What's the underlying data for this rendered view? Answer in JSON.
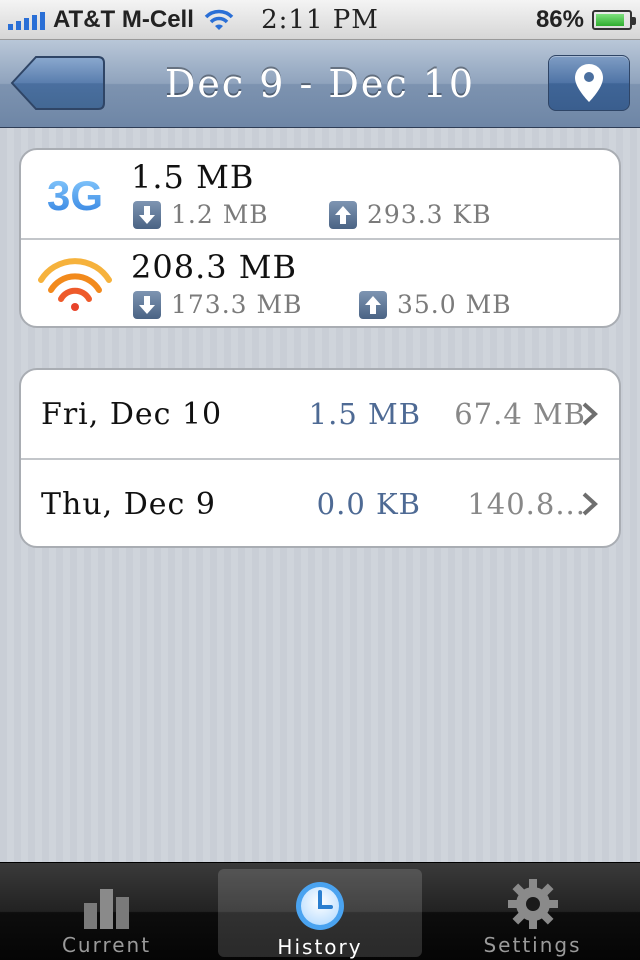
{
  "status_bar": {
    "carrier": "AT&T M-Cell",
    "time": "2:11 PM",
    "battery": "86%",
    "battery_level": 0.86,
    "signal_icon": "signal-bars-icon",
    "wifi_icon": "wifi-icon"
  },
  "nav": {
    "title": "Dec 9 - Dec 10",
    "back_icon": "back-arrow-icon",
    "map_icon": "map-pin-icon"
  },
  "summary": {
    "cellular": {
      "badge": "3G",
      "total": "1.5 MB",
      "download": "1.2 MB",
      "upload": "293.3 KB"
    },
    "wifi": {
      "icon": "wifi-icon",
      "total": "208.3 MB",
      "download": "173.3 MB",
      "upload": "35.0 MB"
    }
  },
  "days": [
    {
      "label": "Fri, Dec 10",
      "cellular": "1.5 MB",
      "wifi": "67.4 MB"
    },
    {
      "label": "Thu, Dec 9",
      "cellular": "0.0 KB",
      "wifi": "140.8..."
    }
  ],
  "tabs": [
    {
      "label": "Current",
      "icon": "bar-chart-icon",
      "selected": false
    },
    {
      "label": "History",
      "icon": "clock-icon",
      "selected": true
    },
    {
      "label": "Settings",
      "icon": "gear-icon",
      "selected": false
    }
  ],
  "colors": {
    "accent_blue": "#4e6a94",
    "wifi_orange": "#f28a1c",
    "cellular_blue": "#3b8fe6"
  }
}
